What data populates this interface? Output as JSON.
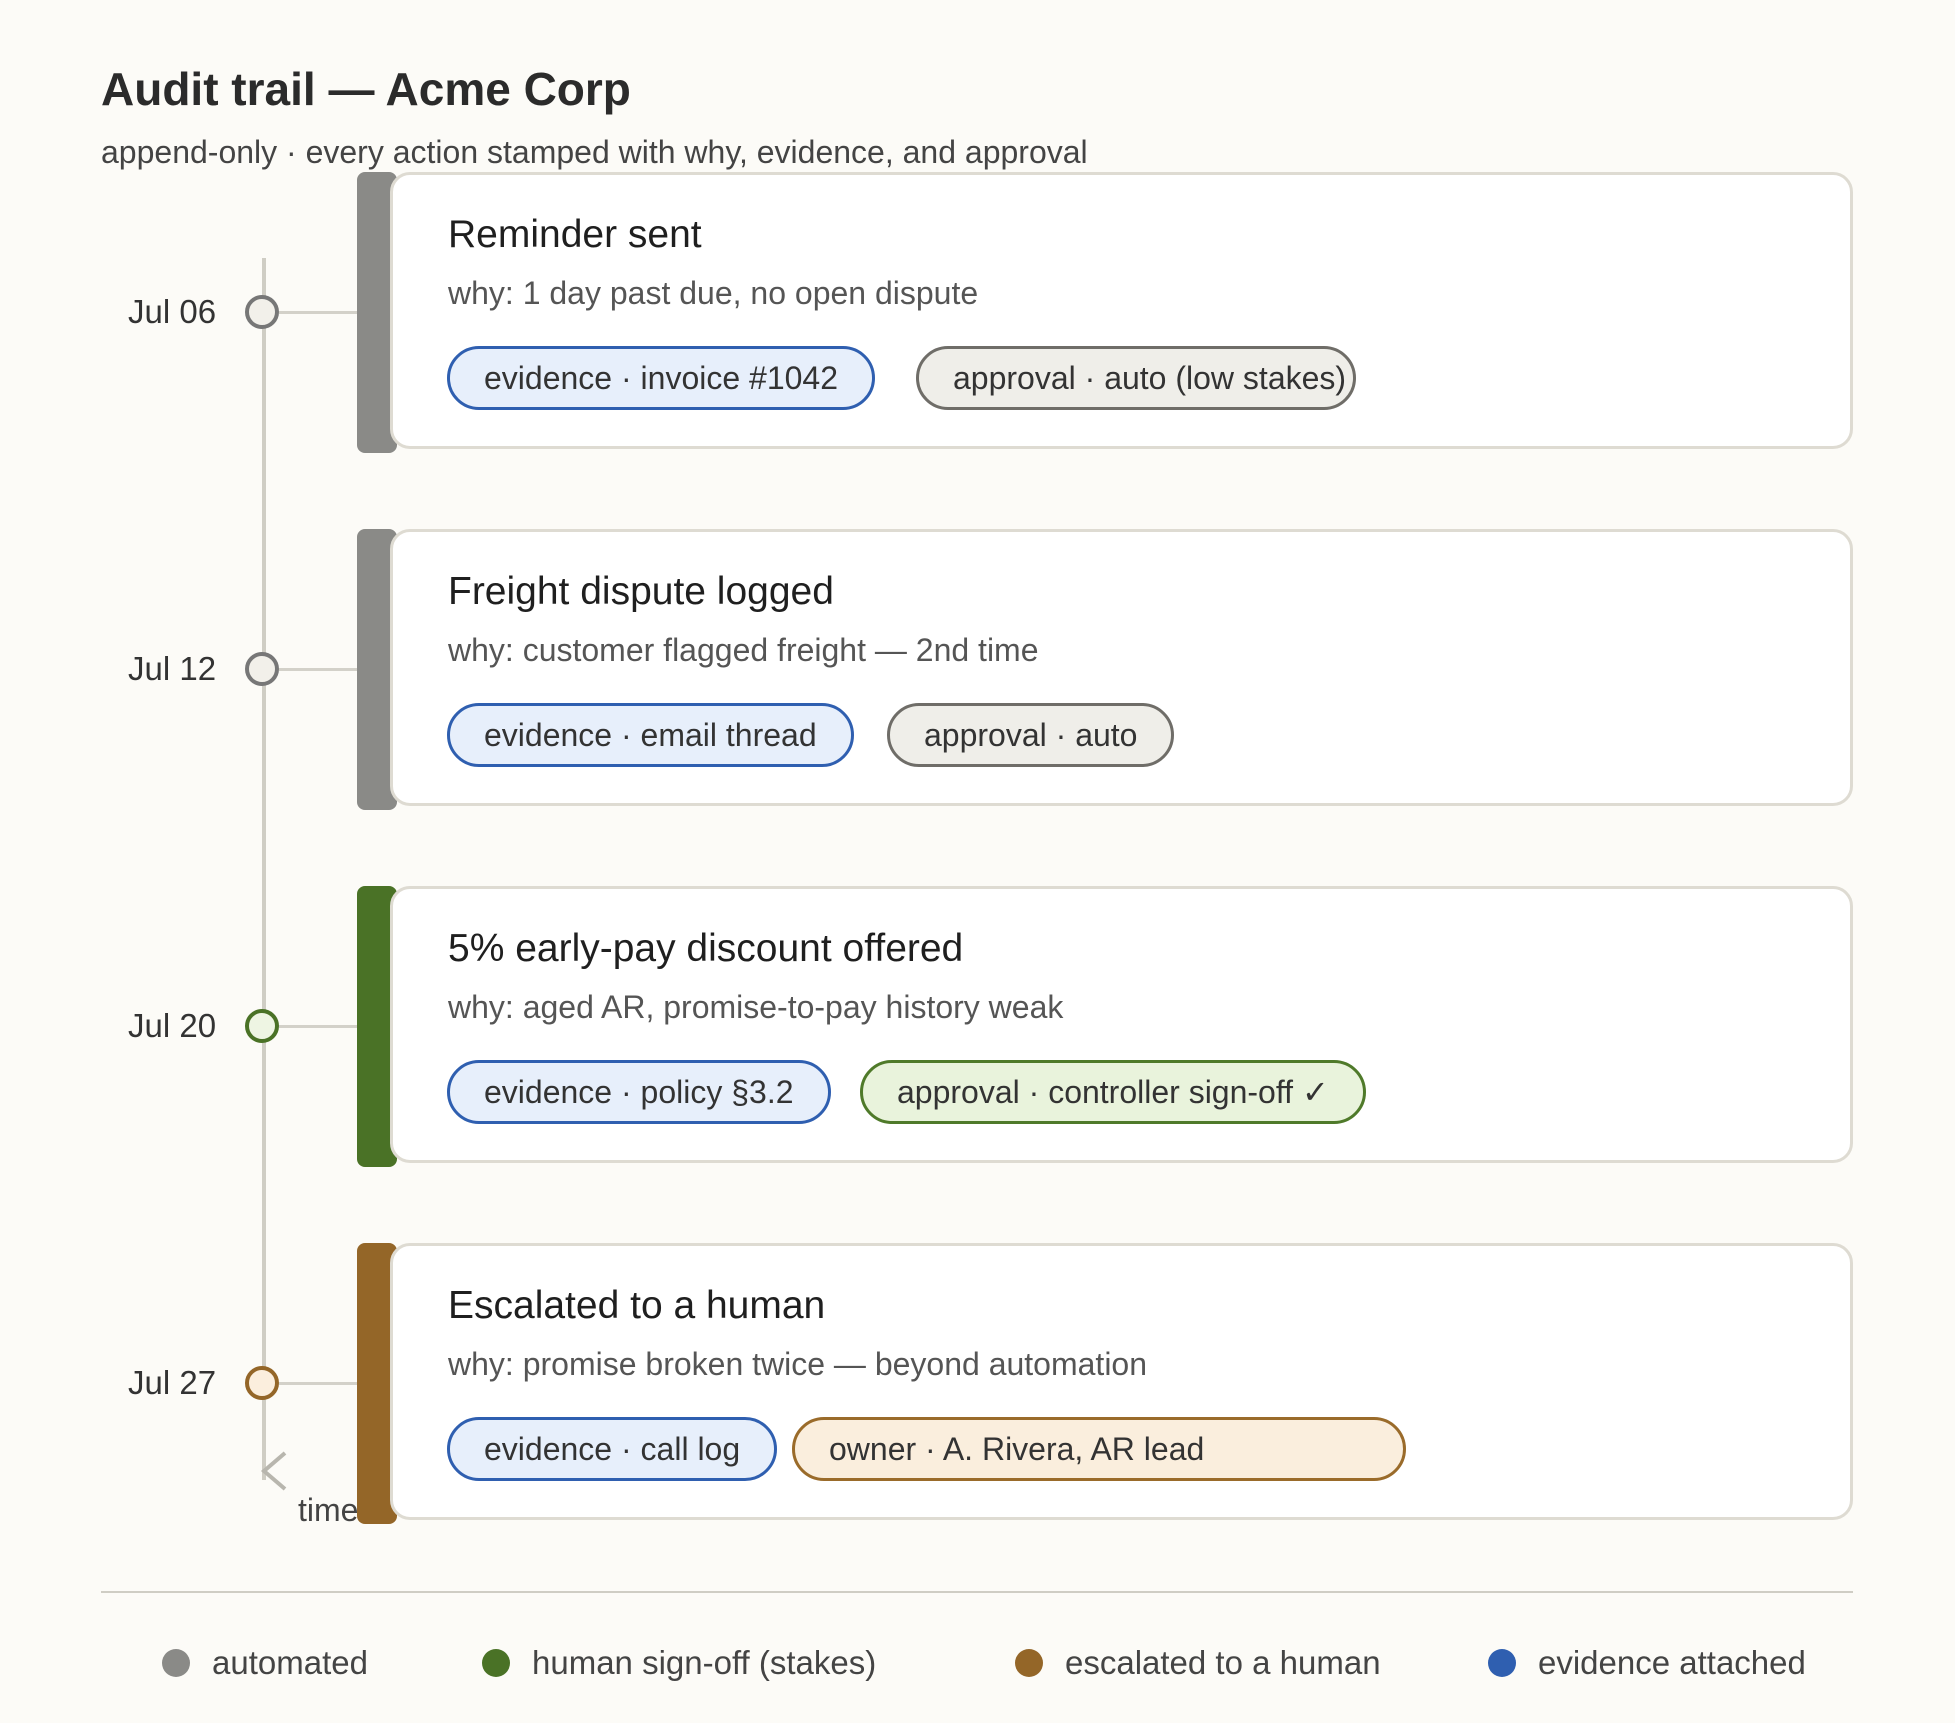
{
  "header": {
    "title": "Audit trail — Acme Corp",
    "subtitle": "append-only · every action stamped with why, evidence, and approval"
  },
  "axis": {
    "label": "time"
  },
  "events": [
    {
      "date": "Jul 06",
      "kind": "automated",
      "title": "Reminder sent",
      "why": "why: 1 day past due, no open dispute",
      "evidence": "evidence · invoice #1042",
      "approval": "approval · auto (low stakes)",
      "approval_kind": "auto"
    },
    {
      "date": "Jul 12",
      "kind": "automated",
      "title": "Freight dispute logged",
      "why": "why: customer flagged freight — 2nd time",
      "evidence": "evidence · email thread",
      "approval": "approval · auto",
      "approval_kind": "auto"
    },
    {
      "date": "Jul 20",
      "kind": "human sign-off",
      "title": "5% early-pay discount offered",
      "why": "why: aged AR, promise-to-pay history weak",
      "evidence": "evidence · policy §3.2",
      "approval": "approval · controller sign-off ✓",
      "approval_kind": "signoff"
    },
    {
      "date": "Jul 27",
      "kind": "escalated",
      "title": "Escalated to a human",
      "why": "why: promise broken twice — beyond automation",
      "evidence": "evidence · call log",
      "approval": "owner · A. Rivera, AR lead",
      "approval_kind": "owner"
    }
  ],
  "legend": [
    {
      "label": "automated",
      "color": "#8a8a87"
    },
    {
      "label": "human sign-off (stakes)",
      "color": "#4a7226"
    },
    {
      "label": "escalated to a human",
      "color": "#946628"
    },
    {
      "label": "evidence attached",
      "color": "#2f5fb0"
    }
  ],
  "colors": {
    "automated": "#8a8a87",
    "signoff": "#4a7226",
    "escalated": "#946628",
    "evidence": "#2f5fb0"
  }
}
